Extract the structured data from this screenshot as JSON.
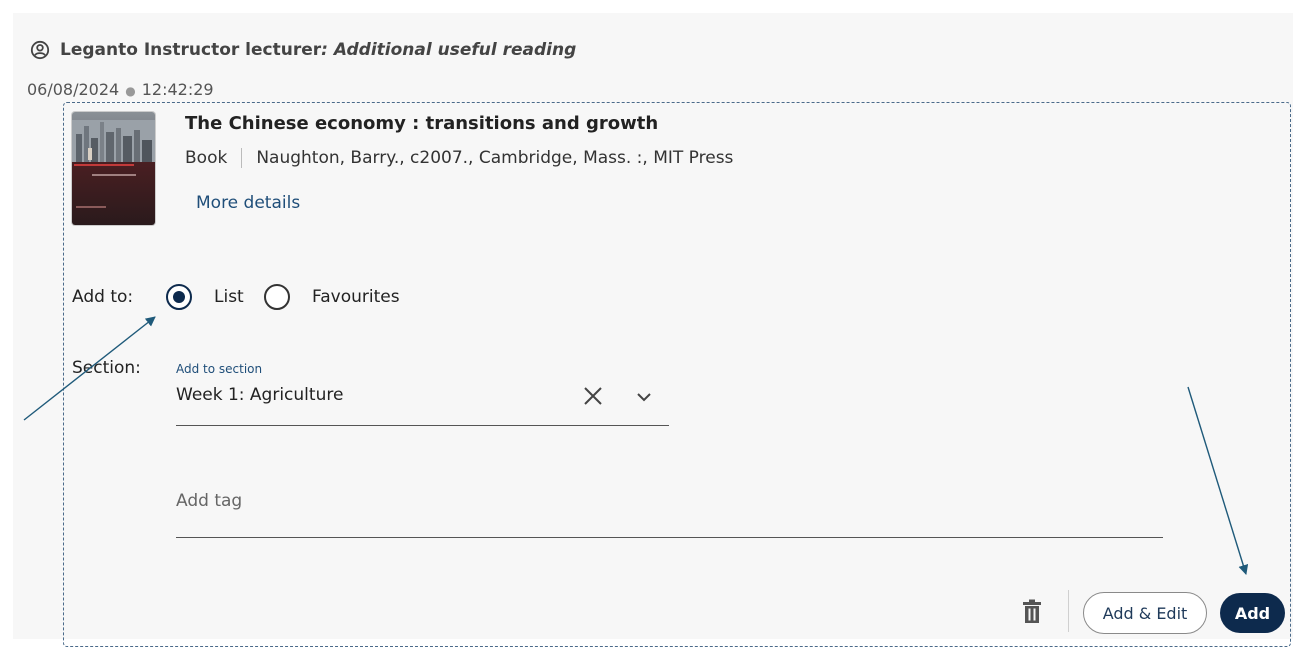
{
  "comment": {
    "author": "Leganto Instructor lecturer",
    "note": ": Additional useful reading",
    "date": "06/08/2024",
    "time": "12:42:29"
  },
  "item": {
    "title": "The Chinese economy : transitions and growth",
    "type": "Book",
    "details": "Naughton, Barry., c2007., Cambridge, Mass. :, MIT Press",
    "more_details_label": "More details"
  },
  "add_to": {
    "label": "Add to:",
    "options": [
      {
        "label": "List",
        "checked": true
      },
      {
        "label": "Favourites",
        "checked": false
      }
    ]
  },
  "section": {
    "label": "Section:",
    "field_label": "Add to section",
    "value": "Week 1: Agriculture"
  },
  "tag": {
    "placeholder": "Add tag"
  },
  "actions": {
    "add_edit_label": "Add & Edit",
    "add_label": "Add"
  },
  "colors": {
    "accent": "#0d2a4d",
    "link": "#1f4e79",
    "annotation_arrow": "#1f5a7a"
  },
  "icons": {
    "user": "user-circle-icon",
    "clear": "close-icon",
    "dropdown": "chevron-down-icon",
    "delete": "trash-icon"
  }
}
